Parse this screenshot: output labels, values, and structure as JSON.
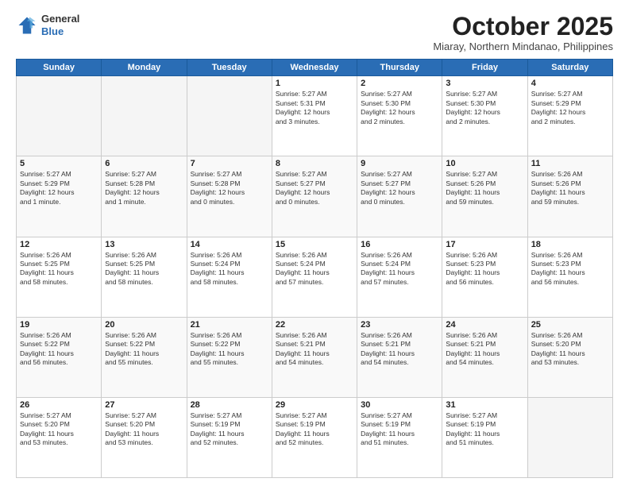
{
  "header": {
    "logo_line1": "General",
    "logo_line2": "Blue",
    "month": "October 2025",
    "location": "Miaray, Northern Mindanao, Philippines"
  },
  "days_of_week": [
    "Sunday",
    "Monday",
    "Tuesday",
    "Wednesday",
    "Thursday",
    "Friday",
    "Saturday"
  ],
  "weeks": [
    [
      {
        "day": "",
        "info": ""
      },
      {
        "day": "",
        "info": ""
      },
      {
        "day": "",
        "info": ""
      },
      {
        "day": "1",
        "info": "Sunrise: 5:27 AM\nSunset: 5:31 PM\nDaylight: 12 hours\nand 3 minutes."
      },
      {
        "day": "2",
        "info": "Sunrise: 5:27 AM\nSunset: 5:30 PM\nDaylight: 12 hours\nand 2 minutes."
      },
      {
        "day": "3",
        "info": "Sunrise: 5:27 AM\nSunset: 5:30 PM\nDaylight: 12 hours\nand 2 minutes."
      },
      {
        "day": "4",
        "info": "Sunrise: 5:27 AM\nSunset: 5:29 PM\nDaylight: 12 hours\nand 2 minutes."
      }
    ],
    [
      {
        "day": "5",
        "info": "Sunrise: 5:27 AM\nSunset: 5:29 PM\nDaylight: 12 hours\nand 1 minute."
      },
      {
        "day": "6",
        "info": "Sunrise: 5:27 AM\nSunset: 5:28 PM\nDaylight: 12 hours\nand 1 minute."
      },
      {
        "day": "7",
        "info": "Sunrise: 5:27 AM\nSunset: 5:28 PM\nDaylight: 12 hours\nand 0 minutes."
      },
      {
        "day": "8",
        "info": "Sunrise: 5:27 AM\nSunset: 5:27 PM\nDaylight: 12 hours\nand 0 minutes."
      },
      {
        "day": "9",
        "info": "Sunrise: 5:27 AM\nSunset: 5:27 PM\nDaylight: 12 hours\nand 0 minutes."
      },
      {
        "day": "10",
        "info": "Sunrise: 5:27 AM\nSunset: 5:26 PM\nDaylight: 11 hours\nand 59 minutes."
      },
      {
        "day": "11",
        "info": "Sunrise: 5:26 AM\nSunset: 5:26 PM\nDaylight: 11 hours\nand 59 minutes."
      }
    ],
    [
      {
        "day": "12",
        "info": "Sunrise: 5:26 AM\nSunset: 5:25 PM\nDaylight: 11 hours\nand 58 minutes."
      },
      {
        "day": "13",
        "info": "Sunrise: 5:26 AM\nSunset: 5:25 PM\nDaylight: 11 hours\nand 58 minutes."
      },
      {
        "day": "14",
        "info": "Sunrise: 5:26 AM\nSunset: 5:24 PM\nDaylight: 11 hours\nand 58 minutes."
      },
      {
        "day": "15",
        "info": "Sunrise: 5:26 AM\nSunset: 5:24 PM\nDaylight: 11 hours\nand 57 minutes."
      },
      {
        "day": "16",
        "info": "Sunrise: 5:26 AM\nSunset: 5:24 PM\nDaylight: 11 hours\nand 57 minutes."
      },
      {
        "day": "17",
        "info": "Sunrise: 5:26 AM\nSunset: 5:23 PM\nDaylight: 11 hours\nand 56 minutes."
      },
      {
        "day": "18",
        "info": "Sunrise: 5:26 AM\nSunset: 5:23 PM\nDaylight: 11 hours\nand 56 minutes."
      }
    ],
    [
      {
        "day": "19",
        "info": "Sunrise: 5:26 AM\nSunset: 5:22 PM\nDaylight: 11 hours\nand 56 minutes."
      },
      {
        "day": "20",
        "info": "Sunrise: 5:26 AM\nSunset: 5:22 PM\nDaylight: 11 hours\nand 55 minutes."
      },
      {
        "day": "21",
        "info": "Sunrise: 5:26 AM\nSunset: 5:22 PM\nDaylight: 11 hours\nand 55 minutes."
      },
      {
        "day": "22",
        "info": "Sunrise: 5:26 AM\nSunset: 5:21 PM\nDaylight: 11 hours\nand 54 minutes."
      },
      {
        "day": "23",
        "info": "Sunrise: 5:26 AM\nSunset: 5:21 PM\nDaylight: 11 hours\nand 54 minutes."
      },
      {
        "day": "24",
        "info": "Sunrise: 5:26 AM\nSunset: 5:21 PM\nDaylight: 11 hours\nand 54 minutes."
      },
      {
        "day": "25",
        "info": "Sunrise: 5:26 AM\nSunset: 5:20 PM\nDaylight: 11 hours\nand 53 minutes."
      }
    ],
    [
      {
        "day": "26",
        "info": "Sunrise: 5:27 AM\nSunset: 5:20 PM\nDaylight: 11 hours\nand 53 minutes."
      },
      {
        "day": "27",
        "info": "Sunrise: 5:27 AM\nSunset: 5:20 PM\nDaylight: 11 hours\nand 53 minutes."
      },
      {
        "day": "28",
        "info": "Sunrise: 5:27 AM\nSunset: 5:19 PM\nDaylight: 11 hours\nand 52 minutes."
      },
      {
        "day": "29",
        "info": "Sunrise: 5:27 AM\nSunset: 5:19 PM\nDaylight: 11 hours\nand 52 minutes."
      },
      {
        "day": "30",
        "info": "Sunrise: 5:27 AM\nSunset: 5:19 PM\nDaylight: 11 hours\nand 51 minutes."
      },
      {
        "day": "31",
        "info": "Sunrise: 5:27 AM\nSunset: 5:19 PM\nDaylight: 11 hours\nand 51 minutes."
      },
      {
        "day": "",
        "info": ""
      }
    ]
  ]
}
